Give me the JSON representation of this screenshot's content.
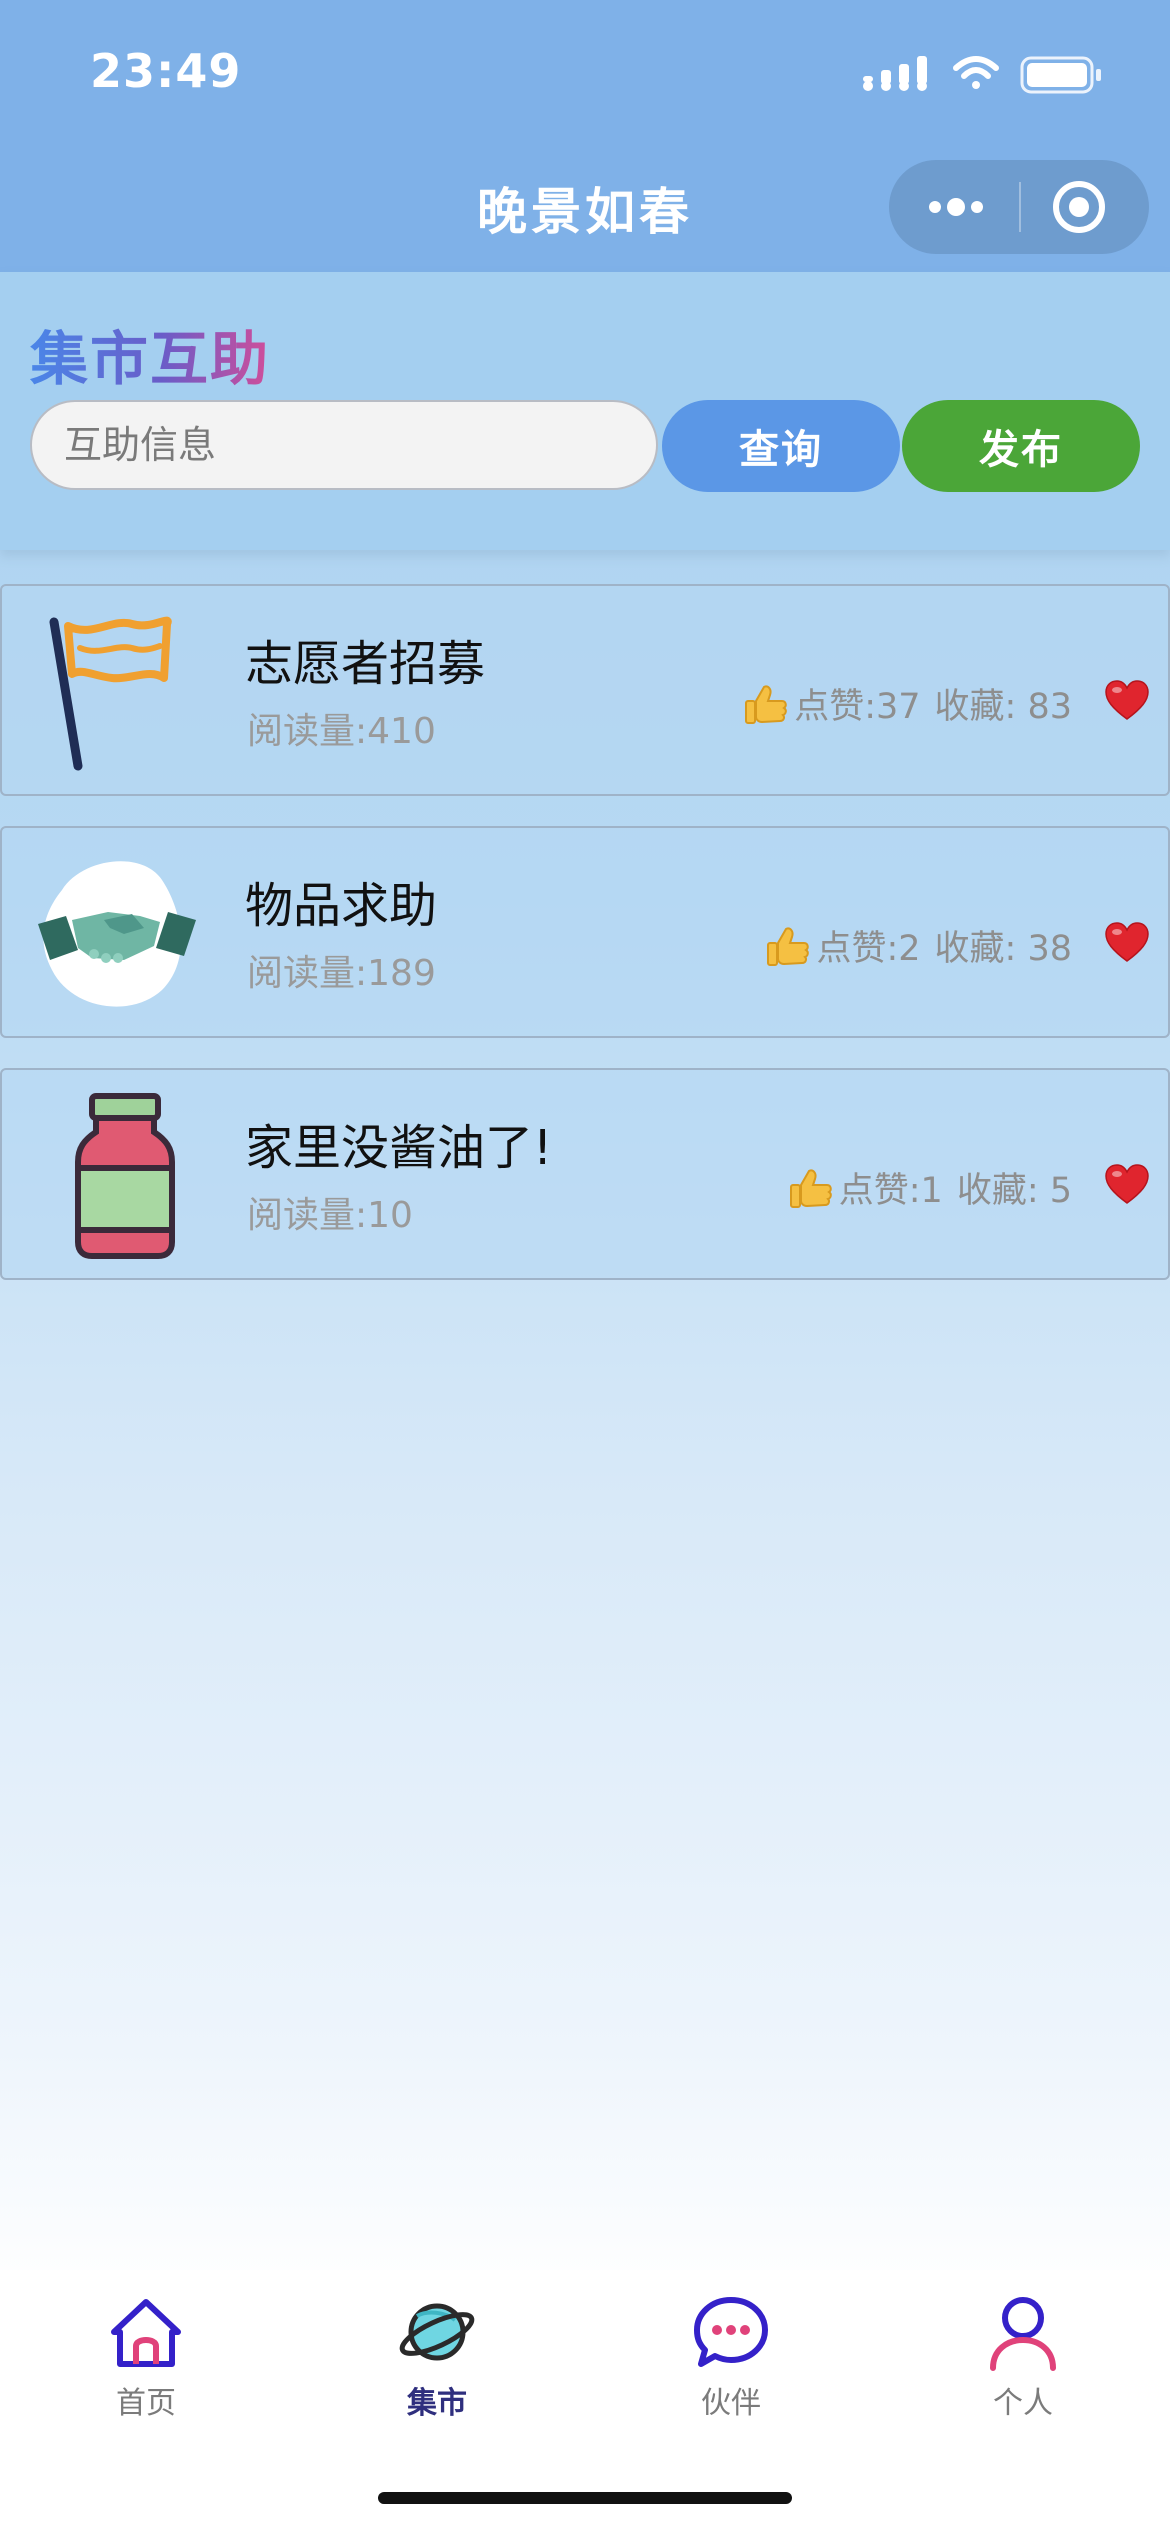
{
  "status_bar": {
    "time": "23:49",
    "icons": [
      "signal-icon",
      "wifi-icon",
      "battery-icon"
    ]
  },
  "nav_bar": {
    "title": "晚景如春",
    "capsule_icons": [
      "more-dots-icon",
      "close-target-icon"
    ]
  },
  "search": {
    "section_title": "集市互助",
    "placeholder": "互助信息",
    "query_label": "查询",
    "publish_label": "发布"
  },
  "colors": {
    "nav_background": "#7fb1e8",
    "query_button": "#5b97e6",
    "publish_button": "#4ba638",
    "title_gradient": [
      "#4a86e8",
      "#6a5cc8",
      "#d04e9a"
    ],
    "active_tab": "#2f2f7e"
  },
  "items": [
    {
      "title": "志愿者招募",
      "reads": "阅读量:410",
      "likes": "点赞:37",
      "favorites": "收藏:  83",
      "thumbnail": "flag-icon"
    },
    {
      "title": "物品求助",
      "reads": "阅读量:189",
      "likes": "点赞:2",
      "favorites": "收藏:  38",
      "thumbnail": "handshake-icon"
    },
    {
      "title": "家里没酱油了!",
      "reads": "阅读量:10",
      "likes": "点赞:1",
      "favorites": "收藏:  5",
      "thumbnail": "bottle-icon"
    }
  ],
  "tabbar": {
    "tabs": [
      {
        "label": "首页",
        "icon": "home-icon",
        "active": false
      },
      {
        "label": "集市",
        "icon": "planet-icon",
        "active": true
      },
      {
        "label": "伙伴",
        "icon": "chat-bubble-icon",
        "active": false
      },
      {
        "label": "个人",
        "icon": "person-icon",
        "active": false
      }
    ]
  }
}
